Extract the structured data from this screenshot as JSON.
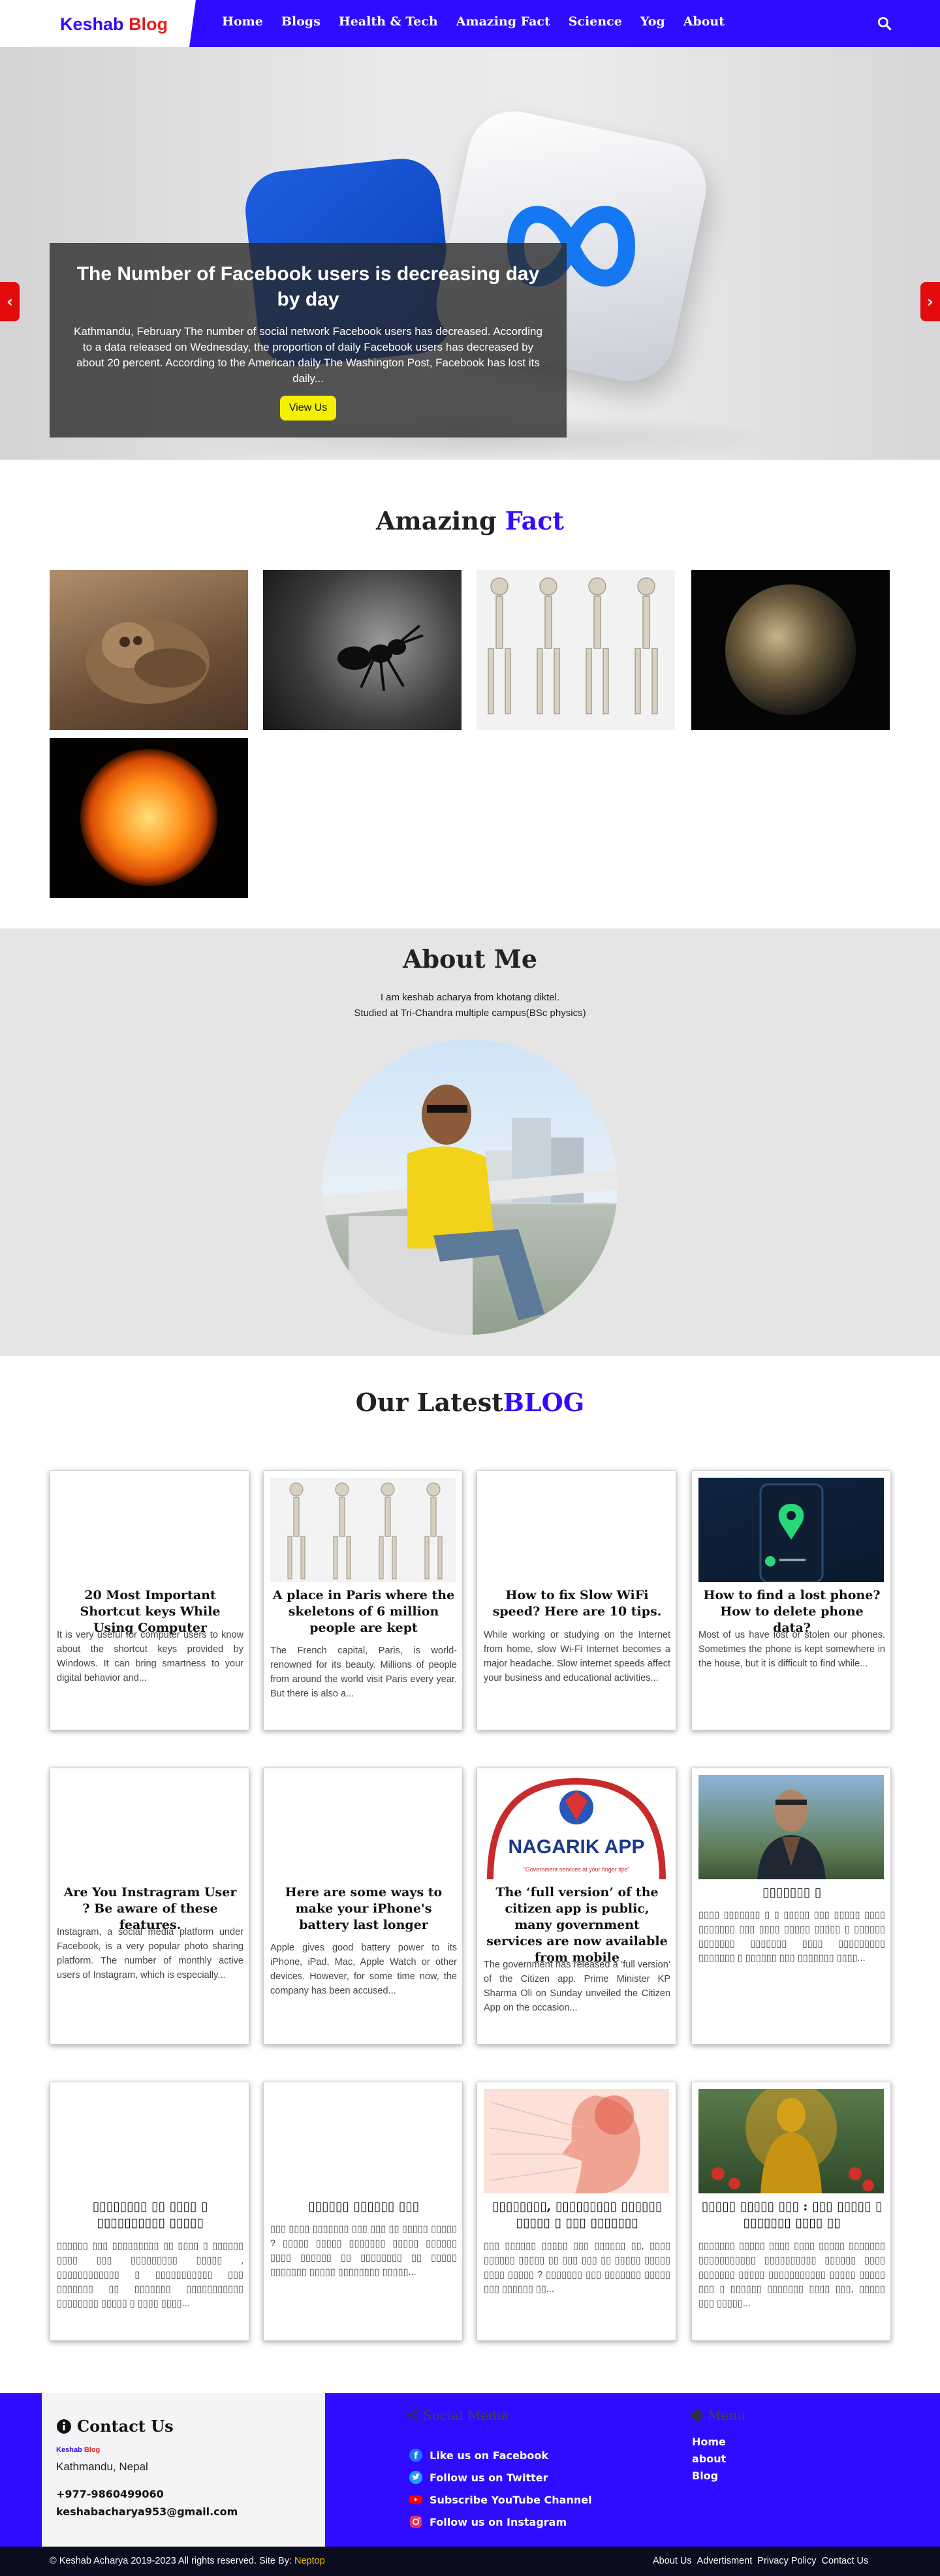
{
  "header": {
    "logo_a": "Keshab",
    "logo_b": "Blog",
    "nav": [
      "Home",
      "Blogs",
      "Health & Tech",
      "Amazing Fact",
      "Science",
      "Yog",
      "About"
    ],
    "brand_color": "#2f0bff"
  },
  "hero": {
    "title": "The Number of Facebook users is decreasing day by day",
    "text": "Kathmandu, February The number of social network Facebook users has decreased. According to a data released on Wednesday, the proportion of daily Facebook users has decreased by about 20 percent. According to the American daily The Washington Post, Facebook has lost its daily...",
    "button": "View Us",
    "prev_icon": "‹",
    "next_icon": "›"
  },
  "amazing": {
    "title_a": "Amazing",
    "title_b": "Fact"
  },
  "about": {
    "title": "About Me",
    "line1": "I am keshab acharya from khotang diktel.",
    "line2": "Studied at Tri-Chandra multiple campus(BSc physics)"
  },
  "blog": {
    "title_a": "Our Latest",
    "title_b": "BLOG",
    "cards": [
      {
        "title": "20 Most Important Shortcut keys While Using Computer",
        "excerpt": "It is very useful for computer users to know about the shortcut keys provided by Windows. It can bring smartness to your digital behavior and..."
      },
      {
        "title": "A place in Paris where the skeletons of 6 million people are kept",
        "excerpt": "The French capital, Paris, is world-renowned for its beauty. Millions of people from around the world visit Paris every year. But there is also a..."
      },
      {
        "title": "How to fix Slow WiFi speed? Here are 10 tips.",
        "excerpt": "While working or studying on the Internet from home, slow Wi-Fi Internet becomes a major headache. Slow internet speeds affect your business and educational activities..."
      },
      {
        "title": "How to find a lost phone? How to delete phone data?",
        "excerpt": "Most of us have lost or stolen our phones. Sometimes the phone is kept somewhere in the house, but it is difficult to find while..."
      },
      {
        "title": "Are You Instragram User ? Be aware of these features.",
        "excerpt": "Instagram, a social media platform under Facebook, is a very popular photo sharing platform. The number of monthly active users of Instagram, which is especially..."
      },
      {
        "title": "Here are some ways to make your iPhone's battery last longer",
        "excerpt": "Apple gives good battery power to its iPhone, iPad, Mac, Apple Watch or other devices. However, for some time now, the company has been accused..."
      },
      {
        "title": "The ‘full version’ of the citizen app is public, many government services are now available from mobile",
        "excerpt": "The government has released a ‘full version’ of the Citizen app. Prime Minister KP Sharma Oli on Sunday unveiled the Citizen App on the occasion..."
      },
      {
        "title": "▯▯▯▯▯▯▯ ▯",
        "excerpt": "▯▯▯▯ ▯▯▯▯▯▯▯ ▯ ▯ ▯▯▯▯▯ ▯▯▯ ▯▯▯▯▯ ▯▯▯▯ ▯▯▯▯▯▯▯ ▯▯▯ ▯▯▯▯ ▯▯▯▯▯ ▯▯▯▯▯ ▯ ▯▯▯▯▯▯ ▯▯▯▯▯▯▯ ▯▯▯▯▯▯▯ ▯▯▯▯ ▯▯▯▯▯▯▯▯▯ ▯▯▯▯▯▯▯ ▯ ▯▯▯▯▯▯ ▯▯▯ ▯▯▯▯▯▯▯ ▯▯▯▯..."
      },
      {
        "title": "▯▯▯▯▯▯▯▯ ▯▯ ▯▯▯▯ ▯ ▯▯▯▯▯▯▯▯▯▯ ▯▯▯▯▯",
        "excerpt": "▯▯▯▯▯▯ ▯▯▯ ▯▯▯▯▯▯▯▯▯ ▯▯ ▯▯▯▯ ▯ ▯▯▯▯▯▯ ▯▯▯▯ ▯▯▯ ▯▯▯▯▯▯▯▯▯ ▯▯▯▯▯ , ▯▯▯▯▯▯▯▯▯▯▯▯ ▯ ▯▯▯▯▯▯▯▯▯▯▯ ▯▯▯ ▯▯▯▯▯▯▯ ▯▯ ▯▯▯▯▯▯▯ ▯▯▯▯▯▯▯▯▯▯▯ ▯▯▯▯▯▯▯▯ ▯▯▯▯▯ ▯ ▯▯▯▯ ▯▯▯▯..."
      },
      {
        "title": "▯▯▯▯▯▯ ▯▯▯▯▯▯ ▯▯▯",
        "excerpt": "▯▯▯ ▯▯▯▯ ▯▯▯▯▯▯▯ ▯▯▯ ▯▯▯ ▯▯ ▯▯▯▯▯ ▯▯▯▯▯ ? ▯▯▯▯▯ ▯▯▯▯▯ ▯▯▯▯▯▯▯ ▯▯▯▯▯ ▯▯▯▯▯▯ ▯▯▯▯ ▯▯▯▯▯▯ ▯▯ ▯▯▯▯▯▯▯▯ ▯▯ ▯▯▯▯▯ ▯▯▯▯▯▯▯ ▯▯▯▯▯ ▯▯▯▯▯▯▯▯ ▯▯▯▯▯..."
      },
      {
        "title": "▯▯▯▯▯▯▯▯, ▯▯▯▯▯▯▯▯▯ ▯▯▯▯▯▯ ▯▯▯▯▯ ▯ ▯▯▯ ▯▯▯▯▯▯▯",
        "excerpt": "▯▯▯ ▯▯▯▯▯▯ ▯▯▯▯▯ ▯▯▯ ▯▯▯▯▯▯ ▯▯, ▯▯▯▯ ▯▯▯▯▯▯ ▯▯▯▯▯ ▯▯ ▯▯▯ ▯▯▯ ▯▯ ▯▯▯▯▯ ▯▯▯▯▯ ▯▯▯▯ ▯▯▯▯▯ ? ▯▯▯▯▯▯▯ ▯▯▯ ▯▯▯▯▯▯▯ ▯▯▯▯▯ ▯▯▯ ▯▯▯▯▯▯ ▯▯..."
      },
      {
        "title": "▯▯▯▯▯ ▯▯▯▯▯ ▯▯▯ : ▯▯▯ ▯▯▯▯▯ ▯ ▯▯▯▯▯▯▯ ▯▯▯▯ ▯▯",
        "excerpt": "▯▯▯▯▯▯▯ ▯▯▯▯▯ ▯▯▯▯ ▯▯▯▯ ▯▯▯▯▯ ▯▯▯▯▯▯▯ ▯▯▯▯▯▯▯▯▯▯▯ ▯▯▯▯▯▯▯▯▯▯ ▯▯▯▯▯▯ ▯▯▯▯ ▯▯▯▯▯▯▯ ▯▯▯▯▯ ▯▯▯▯▯▯▯▯▯▯▯ ▯▯▯▯▯ ▯▯▯▯▯ ▯▯▯ ▯ ▯▯▯▯▯▯ ▯▯▯▯▯▯▯ ▯▯▯▯ ▯▯▯, ▯▯▯▯▯ ▯▯▯ ▯▯▯▯▯..."
      }
    ]
  },
  "footer": {
    "contact_title": "Contact Us",
    "mini_logo_a": "Keshab",
    "mini_logo_b": "Blog",
    "address": "Kathmandu, Nepal",
    "phone": "+977-9860499060",
    "email": "keshabacharya953@gmail.com",
    "social_title": "Social Media",
    "social": [
      "Like us on Facebook",
      "Follow us on Twitter",
      "Subscribe YouTube Channel",
      "Follow us on Instagram"
    ],
    "menu_title": "Menu",
    "menu": [
      "Home",
      "about",
      "Blog"
    ]
  },
  "copyright": {
    "text": "© Keshab Acharya 2019-2023 All rights reserved. Site By:",
    "site_by": "Neptop",
    "links": [
      "About Us",
      "Advertisment",
      "Privacy Policy",
      "Contact Us"
    ]
  }
}
